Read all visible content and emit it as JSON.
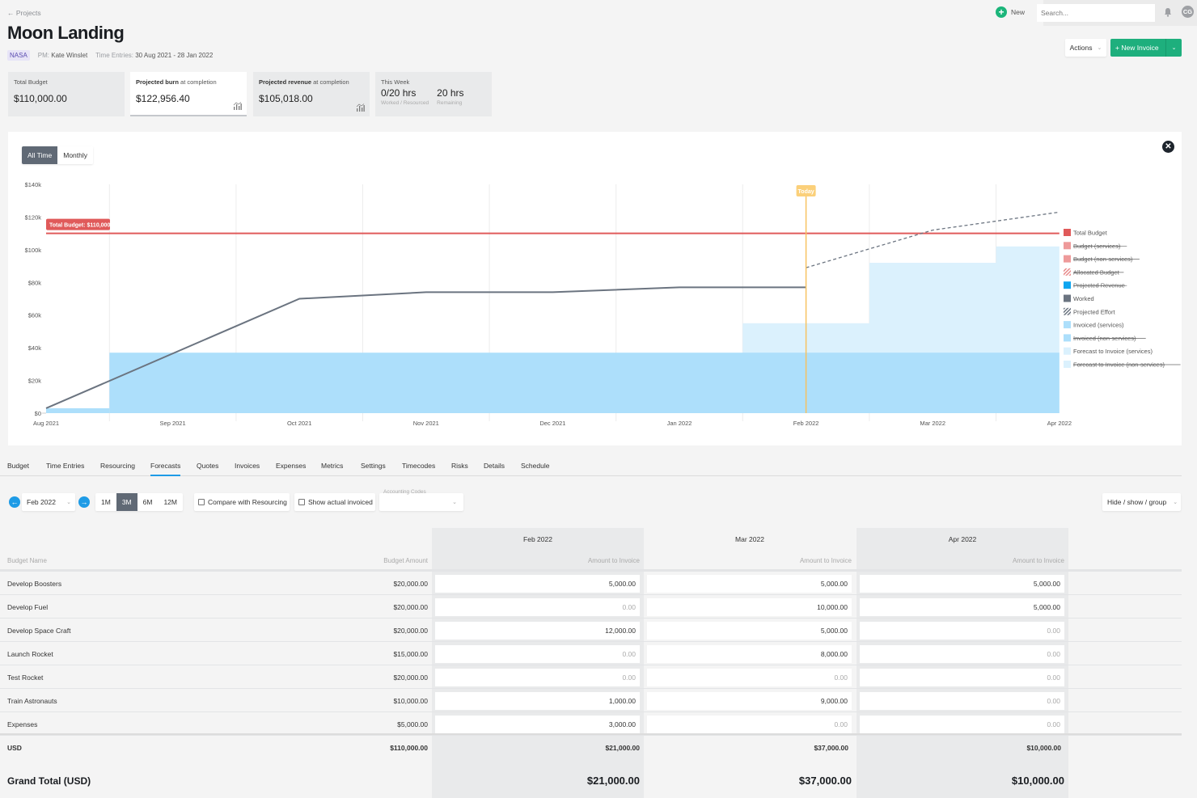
{
  "header": {
    "back_label": "← Projects",
    "title": "Moon Landing",
    "client": "NASA",
    "pm_label": "PM:",
    "pm_name": "Kate Winslet",
    "time_entries_label": "Time Entries:",
    "time_entries_range": "30 Aug 2021 - 28 Jan 2022"
  },
  "topbar": {
    "new_label": "New",
    "search_placeholder": "Search...",
    "avatar_initials": "CG"
  },
  "actions": {
    "actions_label": "Actions",
    "new_invoice_label": "+ New Invoice"
  },
  "stats": {
    "total_budget_label": "Total Budget",
    "total_budget_value": "$110,000.00",
    "projected_burn_bold": "Projected burn",
    "projected_burn_rest": " at completion",
    "projected_burn_value": "$122,956.40",
    "projected_revenue_bold": "Projected revenue",
    "projected_revenue_rest": " at completion",
    "projected_revenue_value": "$105,018.00",
    "this_week_label": "This Week",
    "worked_value": "0/20 hrs",
    "worked_sub": "Worked / Resourced",
    "remaining_value": "20 hrs",
    "remaining_sub": "Remaining"
  },
  "chart_toggle": {
    "all_time": "All Time",
    "monthly": "Monthly"
  },
  "chart_data": {
    "type": "bar",
    "title": "",
    "xlabel": "",
    "ylabel": "",
    "ylim": [
      0,
      140000
    ],
    "y_ticks": [
      "$0",
      "$20k",
      "$40k",
      "$60k",
      "$80k",
      "$100k",
      "$120k",
      "$140k"
    ],
    "x_ticks": [
      "Aug 2021",
      "Sep 2021",
      "Oct 2021",
      "Nov 2021",
      "Dec 2021",
      "Jan 2022",
      "Feb 2022",
      "Mar 2022",
      "Apr 2022"
    ],
    "grid": true,
    "total_budget": 110000,
    "total_budget_label": "Total Budget: $110,000",
    "today_label": "Today",
    "today_x": 6.0,
    "invoiced_services": [
      {
        "from": 0.0,
        "to": 0.5,
        "value": 3000
      },
      {
        "from": 0.5,
        "to": 8.0,
        "value": 37000
      }
    ],
    "forecast_to_invoice": [
      {
        "from": 5.5,
        "to": 6.5,
        "value": 55000
      },
      {
        "from": 6.5,
        "to": 7.5,
        "value": 92000
      },
      {
        "from": 7.5,
        "to": 8.0,
        "value": 102000
      }
    ],
    "worked": [
      {
        "x": 0.0,
        "y": 3000
      },
      {
        "x": 2.0,
        "y": 70000
      },
      {
        "x": 3.0,
        "y": 74000
      },
      {
        "x": 4.0,
        "y": 74000
      },
      {
        "x": 5.0,
        "y": 77000
      },
      {
        "x": 6.0,
        "y": 77000
      }
    ],
    "projected_effort": [
      {
        "x": 6.0,
        "y": 89000
      },
      {
        "x": 7.0,
        "y": 112000
      },
      {
        "x": 8.0,
        "y": 123000
      }
    ],
    "legend_position": "right",
    "legend": [
      {
        "label": "Total Budget",
        "color": "#e05a5a",
        "swatch": "solid",
        "hidden": false
      },
      {
        "label": "Budget (services)",
        "color": "#ee9a9a",
        "swatch": "solid",
        "hidden": true
      },
      {
        "label": "Budget (non-services)",
        "color": "#ee9a9a",
        "swatch": "solid",
        "hidden": true
      },
      {
        "label": "Allocated Budget",
        "color": "#e88a8a",
        "swatch": "hatch",
        "hidden": true
      },
      {
        "label": "Projected Revenue",
        "color": "#0ea5f0",
        "swatch": "solid",
        "hidden": true
      },
      {
        "label": "Worked",
        "color": "#6b7480",
        "swatch": "solid",
        "hidden": false
      },
      {
        "label": "Projected Effort",
        "color": "#6b7480",
        "swatch": "hatch",
        "hidden": false
      },
      {
        "label": "Invoiced (services)",
        "color": "#addffb",
        "swatch": "solid",
        "hidden": false
      },
      {
        "label": "Invoiced (non-services)",
        "color": "#addffb",
        "swatch": "solid",
        "hidden": true
      },
      {
        "label": "Forecast to Invoice (services)",
        "color": "#dbf1fd",
        "swatch": "solid",
        "hidden": false
      },
      {
        "label": "Forecast to Invoice (non-services)",
        "color": "#dbf1fd",
        "swatch": "solid",
        "hidden": true
      }
    ]
  },
  "tabs": [
    {
      "label": "Budget",
      "active": false
    },
    {
      "label": "Time Entries",
      "active": false
    },
    {
      "label": "Resourcing",
      "active": false
    },
    {
      "label": "Forecasts",
      "active": true
    },
    {
      "label": "Quotes",
      "active": false
    },
    {
      "label": "Invoices",
      "active": false
    },
    {
      "label": "Expenses",
      "active": false
    },
    {
      "label": "Metrics",
      "active": false
    },
    {
      "label": "Settings",
      "active": false
    },
    {
      "label": "Timecodes",
      "active": false
    },
    {
      "label": "Risks",
      "active": false
    },
    {
      "label": "Details",
      "active": false
    },
    {
      "label": "Schedule",
      "active": false
    }
  ],
  "controls": {
    "month_value": "Feb 2022",
    "ranges": [
      "1M",
      "3M",
      "6M",
      "12M"
    ],
    "active_range": "3M",
    "compare_resourcing": "Compare with Resourcing",
    "show_actual_invoiced": "Show actual invoiced",
    "accounting_codes_label": "Accounting Codes",
    "accounting_codes_value": "",
    "hide_show_group": "Hide / show / group"
  },
  "table": {
    "budget_name_header": "Budget Name",
    "budget_amount_header": "Budget Amount",
    "months": [
      {
        "label": "Feb 2022",
        "sub": "Amount to Invoice",
        "total": "$21,000.00",
        "grand_total": "$21,000.00"
      },
      {
        "label": "Mar 2022",
        "sub": "Amount to Invoice",
        "total": "$37,000.00",
        "grand_total": "$37,000.00"
      },
      {
        "label": "Apr 2022",
        "sub": "Amount to Invoice",
        "total": "$10,000.00",
        "grand_total": "$10,000.00"
      }
    ],
    "rows": [
      {
        "name": "Develop Boosters",
        "amount": "$20,000.00",
        "values": [
          "5,000.00",
          "5,000.00",
          "5,000.00"
        ]
      },
      {
        "name": "Develop Fuel",
        "amount": "$20,000.00",
        "values": [
          "0.00",
          "10,000.00",
          "5,000.00"
        ]
      },
      {
        "name": "Develop Space Craft",
        "amount": "$20,000.00",
        "values": [
          "12,000.00",
          "5,000.00",
          "0.00"
        ]
      },
      {
        "name": "Launch Rocket",
        "amount": "$15,000.00",
        "values": [
          "0.00",
          "8,000.00",
          "0.00"
        ]
      },
      {
        "name": "Test Rocket",
        "amount": "$20,000.00",
        "values": [
          "0.00",
          "0.00",
          "0.00"
        ]
      },
      {
        "name": "Train Astronauts",
        "amount": "$10,000.00",
        "values": [
          "1,000.00",
          "9,000.00",
          "0.00"
        ]
      },
      {
        "name": "Expenses",
        "amount": "$5,000.00",
        "values": [
          "3,000.00",
          "0.00",
          "0.00"
        ]
      }
    ],
    "currency_label": "USD",
    "currency_total": "$110,000.00",
    "grand_total_label": "Grand Total (USD)"
  }
}
